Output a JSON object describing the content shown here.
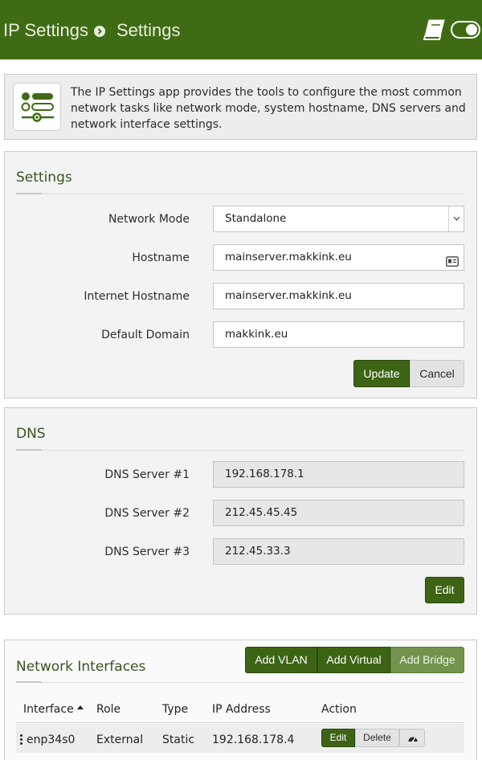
{
  "header": {
    "breadcrumb_app": "IP Settings",
    "breadcrumb_page": "Settings",
    "icons": [
      "book-icon",
      "toggle-icon"
    ]
  },
  "intro": {
    "icon": "settings-sliders-icon",
    "text": "The IP Settings app provides the tools to configure the most common network tasks like network mode, system hostname, DNS servers and network interface settings."
  },
  "settings": {
    "title": "Settings",
    "network_mode_label": "Network Mode",
    "network_mode_value": "Standalone",
    "hostname_label": "Hostname",
    "hostname_value": "mainserver.makkink.eu",
    "internet_hostname_label": "Internet Hostname",
    "internet_hostname_value": "mainserver.makkink.eu",
    "default_domain_label": "Default Domain",
    "default_domain_value": "makkink.eu",
    "update_label": "Update",
    "cancel_label": "Cancel"
  },
  "dns": {
    "title": "DNS",
    "servers": [
      {
        "label": "DNS Server #1",
        "value": "192.168.178.1"
      },
      {
        "label": "DNS Server #2",
        "value": "212.45.45.45"
      },
      {
        "label": "DNS Server #3",
        "value": "212.45.33.3"
      }
    ],
    "edit_label": "Edit"
  },
  "network_interfaces": {
    "title": "Network Interfaces",
    "add_vlan_label": "Add VLAN",
    "add_virtual_label": "Add Virtual",
    "add_bridge_label": "Add Bridge",
    "columns": [
      "Interface",
      "Role",
      "Type",
      "IP Address",
      "Action"
    ],
    "rows": [
      {
        "interface": "enp34s0",
        "role": "External",
        "type": "Static",
        "ip": "192.168.178.4",
        "edit_label": "Edit",
        "delete_label": "Delete"
      }
    ]
  },
  "colors": {
    "brand_green": "#3f6b15",
    "button_green": "#3d6415",
    "bridge_green": "#72944d"
  }
}
